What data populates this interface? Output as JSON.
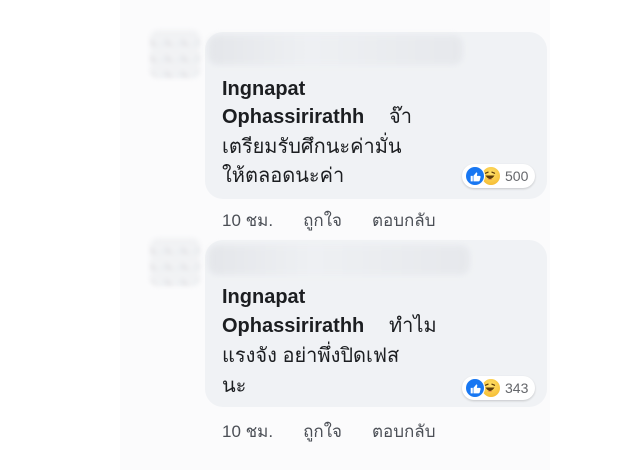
{
  "comments": [
    {
      "author_line1": "Ingnapat",
      "author_line2": "Ophassirirathh",
      "text_line1_tail": "จ๊า",
      "text_line2": "เตรียมรับศึกนะค่ามั่น",
      "text_line3": "ให้ตลอดนะค่า",
      "reaction_icons": [
        "like-icon",
        "haha-icon"
      ],
      "reaction_count": "500",
      "time": "10 ชม.",
      "like_label": "ถูกใจ",
      "reply_label": "ตอบกลับ"
    },
    {
      "author_line1": "Ingnapat",
      "author_line2": "Ophassirirathh",
      "text_line1_tail": "ทำไม",
      "text_line2": "แรงจัง อย่าพึ่งปิดเฟส",
      "text_line3": "นะ",
      "reaction_icons": [
        "like-icon",
        "haha-icon"
      ],
      "reaction_count": "343",
      "time": "10 ชม.",
      "like_label": "ถูกใจ",
      "reply_label": "ตอบกลับ"
    }
  ],
  "colors": {
    "bubble": "#f0f2f5",
    "like_blue": "#1877f2",
    "meta_text": "#4b4f56"
  }
}
